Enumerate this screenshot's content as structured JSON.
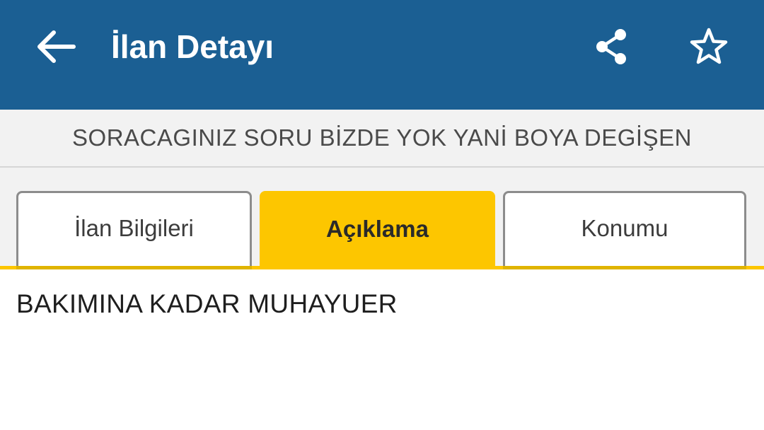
{
  "header": {
    "title": "İlan Detayı",
    "background_color": "#1b5f93",
    "icons": {
      "back": "arrow-left-icon",
      "share": "share-icon",
      "favorite": "star-outline-icon"
    }
  },
  "listing": {
    "title": "SORACAGINIZ SORU BİZDE YOK YANİ BOYA DEGİŞEN"
  },
  "tabs": [
    {
      "label": "İlan Bilgileri",
      "active": false
    },
    {
      "label": "Açıklama",
      "active": true
    },
    {
      "label": "Konumu",
      "active": false
    }
  ],
  "tab_active_color": "#fdc600",
  "description": {
    "text": "BAKIMINA KADAR MUHAYUER"
  }
}
